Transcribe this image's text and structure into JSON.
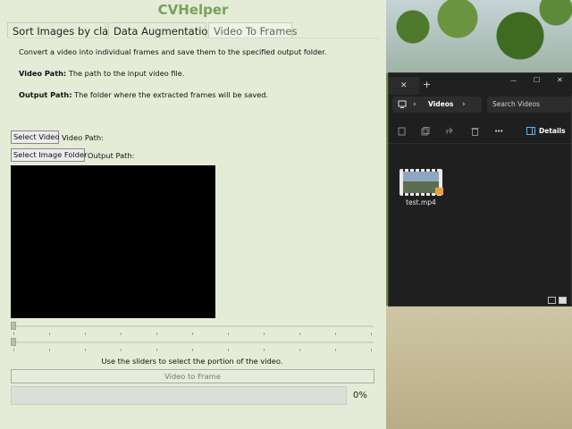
{
  "app": {
    "title": "CVHelper",
    "tabs": [
      "Sort Images by class",
      "Data Augmentation",
      "Video To Frames"
    ],
    "active_tab": "Video To Frames",
    "description": "Convert a video into individual frames and save them to the specified output folder.",
    "video_path_heading": "Video Path:",
    "video_path_desc": "The path to the input video file.",
    "output_path_heading": "Output Path:",
    "output_path_desc": "The folder where the extracted frames will be saved.",
    "select_video_label": "Select Video",
    "video_path_label": "Video Path:",
    "select_folder_label": "Select Image Folder",
    "output_path_label": "Output Path:",
    "slider_hint": "Use the sliders to select the portion of the video.",
    "video_to_frame_label": "Video to Frame",
    "progress_value": 0,
    "progress_text": "0%",
    "accent_color": "#7aa05a"
  },
  "explorer": {
    "close_glyph": "✕",
    "new_tab_glyph": "+",
    "minimize_glyph": "—",
    "maximize_glyph": "☐",
    "window_close_glyph": "✕",
    "breadcrumb_arrow": "›",
    "location": "Videos",
    "location_arrow": "›",
    "search_placeholder": "Search Videos",
    "details_label": "Details",
    "more_glyph": "•••",
    "file_name": "test.mp4",
    "icons": [
      "computer-icon",
      "cut-icon",
      "copy-icon",
      "share-icon",
      "delete-icon",
      "details-pane-icon",
      "list-view-icon",
      "tiles-view-icon"
    ]
  }
}
